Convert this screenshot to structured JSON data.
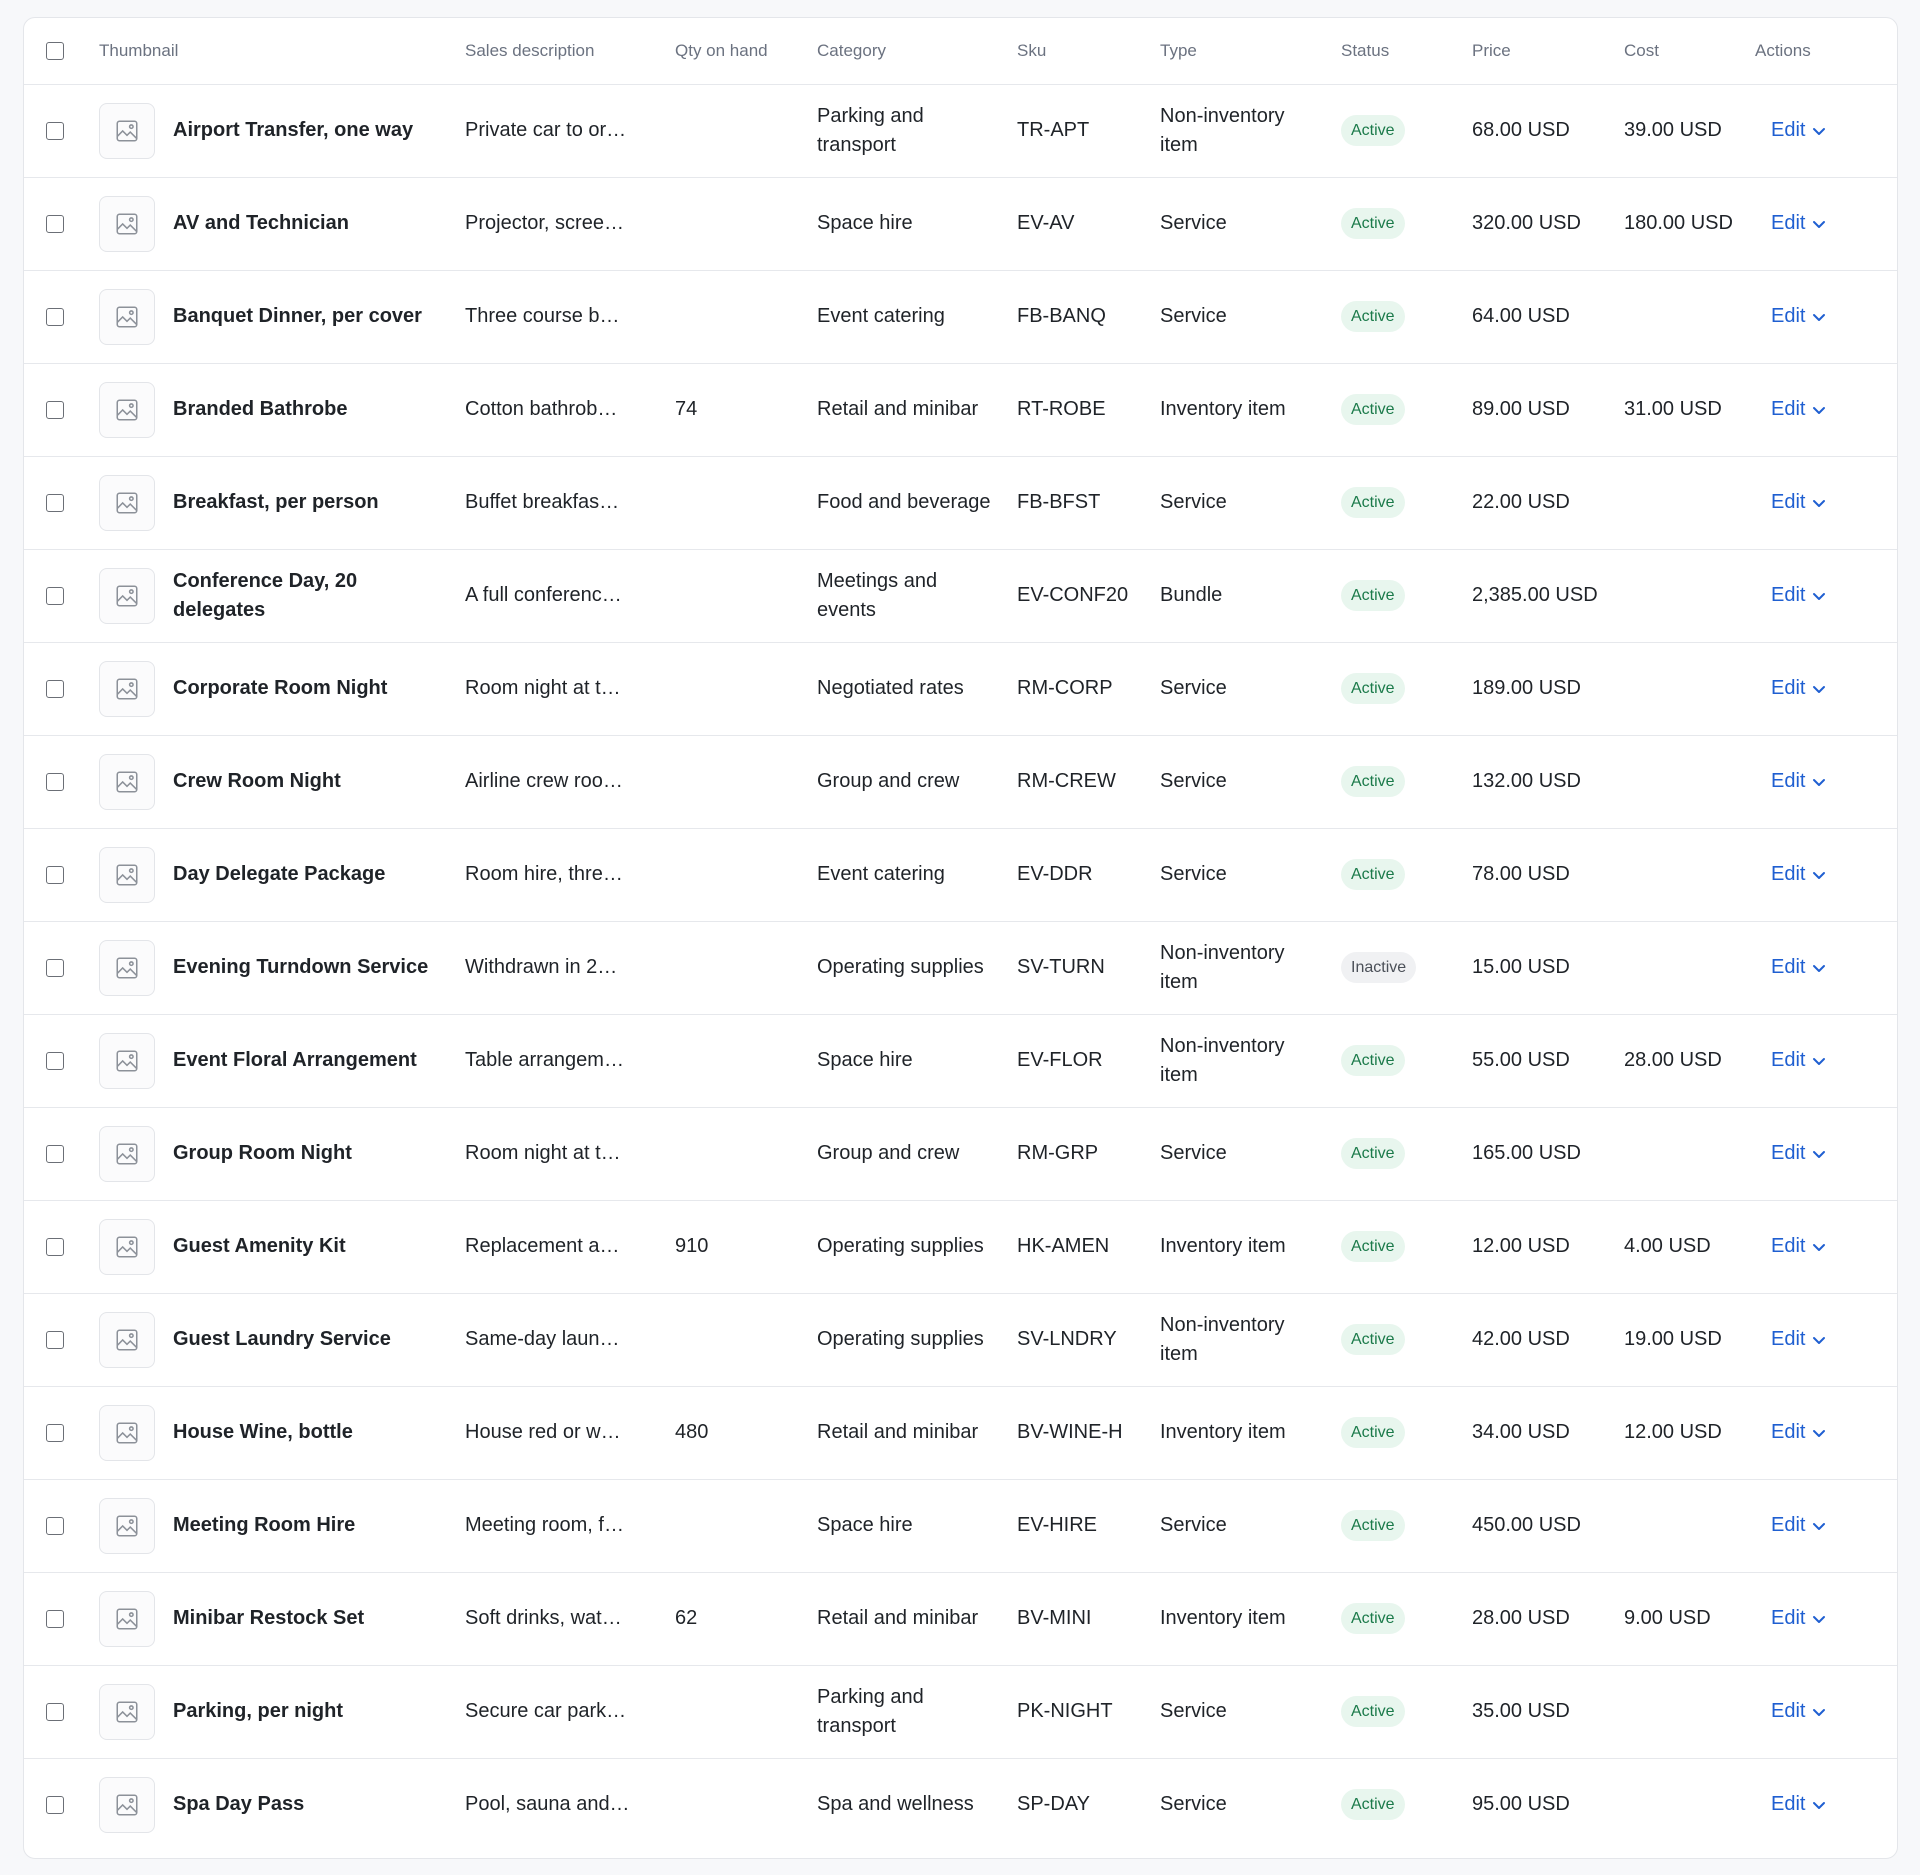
{
  "colors": {
    "accent": "#1f5fd1",
    "active_bg": "#e8f6ee",
    "active_text": "#1b7a4a",
    "inactive_bg": "#f0f1f3"
  },
  "columns": {
    "thumbnail": "Thumbnail",
    "sales_description": "Sales description",
    "qty_on_hand": "Qty on hand",
    "category": "Category",
    "sku": "Sku",
    "type": "Type",
    "status": "Status",
    "price": "Price",
    "cost": "Cost",
    "actions": "Actions"
  },
  "edit_label": "Edit",
  "icons": {
    "thumbnail": "image-placeholder-icon",
    "dropdown": "chevron-down-icon"
  },
  "items": [
    {
      "name": "Airport Transfer, one way",
      "desc": "Private car to or…",
      "qty": "",
      "category": "Parking and transport",
      "sku": "TR-APT",
      "type": "Non-inventory item",
      "status": "Active",
      "price": "68.00 USD",
      "cost": "39.00 USD"
    },
    {
      "name": "AV and Technician",
      "desc": "Projector, scree…",
      "qty": "",
      "category": "Space hire",
      "sku": "EV-AV",
      "type": "Service",
      "status": "Active",
      "price": "320.00 USD",
      "cost": "180.00 USD"
    },
    {
      "name": "Banquet Dinner, per cover",
      "desc": "Three course b…",
      "qty": "",
      "category": "Event catering",
      "sku": "FB-BANQ",
      "type": "Service",
      "status": "Active",
      "price": "64.00 USD",
      "cost": ""
    },
    {
      "name": "Branded Bathrobe",
      "desc": "Cotton bathrob…",
      "qty": "74",
      "category": "Retail and minibar",
      "sku": "RT-ROBE",
      "type": "Inventory item",
      "status": "Active",
      "price": "89.00 USD",
      "cost": "31.00 USD"
    },
    {
      "name": "Breakfast, per person",
      "desc": "Buffet breakfas…",
      "qty": "",
      "category": "Food and beverage",
      "sku": "FB-BFST",
      "type": "Service",
      "status": "Active",
      "price": "22.00 USD",
      "cost": ""
    },
    {
      "name": "Conference Day, 20 delegates",
      "desc": "A full conferenc…",
      "qty": "",
      "category": "Meetings and events",
      "sku": "EV-CONF20",
      "type": "Bundle",
      "status": "Active",
      "price": "2,385.00 USD",
      "cost": ""
    },
    {
      "name": "Corporate Room Night",
      "desc": "Room night at t…",
      "qty": "",
      "category": "Negotiated rates",
      "sku": "RM-CORP",
      "type": "Service",
      "status": "Active",
      "price": "189.00 USD",
      "cost": ""
    },
    {
      "name": "Crew Room Night",
      "desc": "Airline crew roo…",
      "qty": "",
      "category": "Group and crew",
      "sku": "RM-CREW",
      "type": "Service",
      "status": "Active",
      "price": "132.00 USD",
      "cost": ""
    },
    {
      "name": "Day Delegate Package",
      "desc": "Room hire, thre…",
      "qty": "",
      "category": "Event catering",
      "sku": "EV-DDR",
      "type": "Service",
      "status": "Active",
      "price": "78.00 USD",
      "cost": ""
    },
    {
      "name": "Evening Turndown Service",
      "desc": "Withdrawn in 2…",
      "qty": "",
      "category": "Operating supplies",
      "sku": "SV-TURN",
      "type": "Non-inventory item",
      "status": "Inactive",
      "price": "15.00 USD",
      "cost": ""
    },
    {
      "name": "Event Floral Arrangement",
      "desc": "Table arrangem…",
      "qty": "",
      "category": "Space hire",
      "sku": "EV-FLOR",
      "type": "Non-inventory item",
      "status": "Active",
      "price": "55.00 USD",
      "cost": "28.00 USD"
    },
    {
      "name": "Group Room Night",
      "desc": "Room night at t…",
      "qty": "",
      "category": "Group and crew",
      "sku": "RM-GRP",
      "type": "Service",
      "status": "Active",
      "price": "165.00 USD",
      "cost": ""
    },
    {
      "name": "Guest Amenity Kit",
      "desc": "Replacement a…",
      "qty": "910",
      "category": "Operating supplies",
      "sku": "HK-AMEN",
      "type": "Inventory item",
      "status": "Active",
      "price": "12.00 USD",
      "cost": "4.00 USD"
    },
    {
      "name": "Guest Laundry Service",
      "desc": "Same-day laun…",
      "qty": "",
      "category": "Operating supplies",
      "sku": "SV-LNDRY",
      "type": "Non-inventory item",
      "status": "Active",
      "price": "42.00 USD",
      "cost": "19.00 USD"
    },
    {
      "name": "House Wine, bottle",
      "desc": "House red or w…",
      "qty": "480",
      "category": "Retail and minibar",
      "sku": "BV-WINE-H",
      "type": "Inventory item",
      "status": "Active",
      "price": "34.00 USD",
      "cost": "12.00 USD"
    },
    {
      "name": "Meeting Room Hire",
      "desc": "Meeting room, f…",
      "qty": "",
      "category": "Space hire",
      "sku": "EV-HIRE",
      "type": "Service",
      "status": "Active",
      "price": "450.00 USD",
      "cost": ""
    },
    {
      "name": "Minibar Restock Set",
      "desc": "Soft drinks, wat…",
      "qty": "62",
      "category": "Retail and minibar",
      "sku": "BV-MINI",
      "type": "Inventory item",
      "status": "Active",
      "price": "28.00 USD",
      "cost": "9.00 USD"
    },
    {
      "name": "Parking, per night",
      "desc": "Secure car park…",
      "qty": "",
      "category": "Parking and transport",
      "sku": "PK-NIGHT",
      "type": "Service",
      "status": "Active",
      "price": "35.00 USD",
      "cost": ""
    },
    {
      "name": "Spa Day Pass",
      "desc": "Pool, sauna and…",
      "qty": "",
      "category": "Spa and wellness",
      "sku": "SP-DAY",
      "type": "Service",
      "status": "Active",
      "price": "95.00 USD",
      "cost": ""
    }
  ]
}
